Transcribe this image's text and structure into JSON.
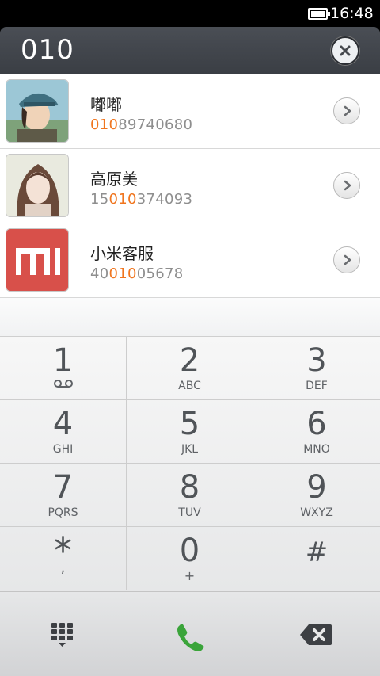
{
  "status_bar": {
    "time": "16:48",
    "battery_level": 1.0,
    "battery_icon": "battery-icon"
  },
  "dial_input": {
    "value": "010",
    "clear_icon": "close-icon"
  },
  "results": [
    {
      "name": "嘟嘟",
      "phone_pre": "",
      "phone_match": "010",
      "phone_post": "89740680",
      "avatar": "avatar-man-cap",
      "detail_icon": "chevron-right-icon"
    },
    {
      "name": "高原美",
      "phone_pre": "15",
      "phone_match": "010",
      "phone_post": "374093",
      "avatar": "avatar-woman",
      "detail_icon": "chevron-right-icon"
    },
    {
      "name": "小米客服",
      "phone_pre": "40",
      "phone_match": "010",
      "phone_post": "05678",
      "avatar": "avatar-mi-logo",
      "detail_icon": "chevron-right-icon"
    }
  ],
  "keypad": [
    {
      "digit": "1",
      "letters": "",
      "sub_icon": "voicemail-icon"
    },
    {
      "digit": "2",
      "letters": "ABC"
    },
    {
      "digit": "3",
      "letters": "DEF"
    },
    {
      "digit": "4",
      "letters": "GHI"
    },
    {
      "digit": "5",
      "letters": "JKL"
    },
    {
      "digit": "6",
      "letters": "MNO"
    },
    {
      "digit": "7",
      "letters": "PQRS"
    },
    {
      "digit": "8",
      "letters": "TUV"
    },
    {
      "digit": "9",
      "letters": "WXYZ"
    },
    {
      "digit": "*",
      "letters": ","
    },
    {
      "digit": "0",
      "letters": "+"
    },
    {
      "digit": "#",
      "letters": ""
    }
  ],
  "actions": {
    "keypad_toggle_icon": "dialpad-icon",
    "call_icon": "phone-icon",
    "backspace_icon": "backspace-icon",
    "call_color": "#3aa43a",
    "highlight_color": "#f0751e"
  }
}
